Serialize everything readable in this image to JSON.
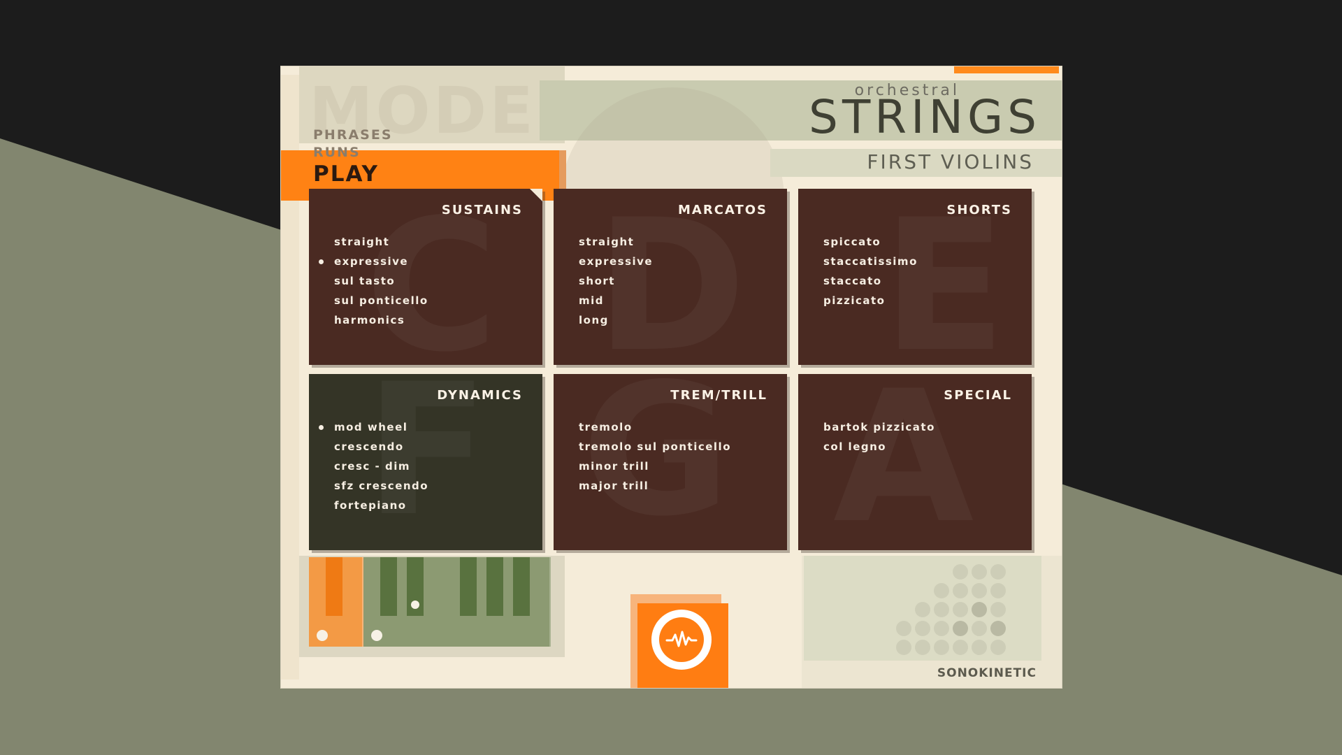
{
  "header": {
    "title_small": "orchestral",
    "title_big": "STRINGS",
    "subtitle": "FIRST VIOLINS"
  },
  "mode_menu": {
    "ghost": "MODE",
    "items": [
      "PHRASES",
      "RUNS"
    ],
    "active": "PLAY"
  },
  "cards": [
    {
      "title": "SUSTAINS",
      "items": [
        "straight",
        "expressive",
        "sul tasto",
        "sul ponticello",
        "harmonics"
      ],
      "selected": "expressive",
      "ghost": "C"
    },
    {
      "title": "MARCATOS",
      "items": [
        "straight",
        "expressive",
        "short",
        "mid",
        "long"
      ],
      "ghost": "D"
    },
    {
      "title": "SHORTS",
      "items": [
        "spiccato",
        "staccatissimo",
        "staccato",
        "pizzicato"
      ],
      "ghost": "E"
    },
    {
      "title": "DYNAMICS",
      "items": [
        "mod wheel",
        "crescendo",
        "cresc - dim",
        "sfz crescendo",
        "fortepiano"
      ],
      "selected": "mod wheel",
      "ghost": "F"
    },
    {
      "title": "TREM/TRILL",
      "items": [
        "tremolo",
        "tremolo sul ponticello",
        "minor trill",
        "major trill"
      ],
      "ghost": "G"
    },
    {
      "title": "SPECIAL",
      "items": [
        "bartok pizzicato",
        "col legno"
      ],
      "ghost": "A"
    }
  ],
  "brand": "SONOKINETIC",
  "colors": {
    "accent": "#ff8214",
    "card_brown": "#4a2a22",
    "card_green": "#343426",
    "panel": "#f5ecd9",
    "sage": "#82866f"
  },
  "icons": {
    "logo": "waveform-circle-icon"
  }
}
